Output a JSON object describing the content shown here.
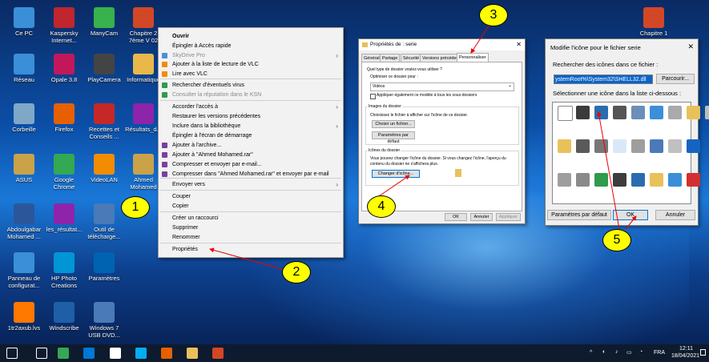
{
  "desktop": {
    "icons": [
      {
        "label": "Ce PC",
        "icon": "computer-icon",
        "color": "#3a8fd8"
      },
      {
        "label": "Kaspersky Internet...",
        "icon": "kaspersky-icon",
        "color": "#c0262d"
      },
      {
        "label": "ManyCam",
        "icon": "manycam-icon",
        "color": "#37b24d"
      },
      {
        "label": "Chapitre 2 7ème V 02",
        "icon": "powerpoint-file-icon",
        "color": "#d24726"
      },
      {
        "label": "Réseau",
        "icon": "network-icon",
        "color": "#3a8fd8"
      },
      {
        "label": "Opale 3.8",
        "icon": "opale-icon",
        "color": "#c2185b"
      },
      {
        "label": "PlayCamera",
        "icon": "camera-icon",
        "color": "#444444"
      },
      {
        "label": "Informatique",
        "icon": "folder-icon",
        "color": "#e8b94a"
      },
      {
        "label": "Corbeille",
        "icon": "recycle-bin-icon",
        "color": "#7fa8c8"
      },
      {
        "label": "Firefox",
        "icon": "firefox-icon",
        "color": "#e66000"
      },
      {
        "label": "Recettes et Conseils ...",
        "icon": "recipe-icon",
        "color": "#c62828"
      },
      {
        "label": "Résultats_d...",
        "icon": "archive-icon",
        "color": "#8e24aa"
      },
      {
        "label": "ASUS",
        "icon": "user-folder-icon",
        "color": "#c9a24a"
      },
      {
        "label": "Google Chrome",
        "icon": "chrome-icon",
        "color": "#34a853"
      },
      {
        "label": "VideoLAN",
        "icon": "vlc-icon",
        "color": "#f28c00"
      },
      {
        "label": "Ahmed Mohamed",
        "icon": "user-folder-icon",
        "color": "#c9a24a"
      },
      {
        "label": "Abdoulgabar Mohamed ...",
        "icon": "word-file-icon",
        "color": "#2b579a"
      },
      {
        "label": "les_résultat...",
        "icon": "archive-icon",
        "color": "#8e24aa"
      },
      {
        "label": "Outil de télécharge...",
        "icon": "download-tool-icon",
        "color": "#4a7ab8"
      },
      {
        "label": "Panneau de configurat...",
        "icon": "control-panel-icon",
        "color": "#3a8fd8"
      },
      {
        "label": "HP Photo Creations",
        "icon": "hp-photo-icon",
        "color": "#0096d6"
      },
      {
        "label": "Paramètres",
        "icon": "settings-gear-icon",
        "color": "#0063b1"
      },
      {
        "label": "1tr2axub.lvs",
        "icon": "avast-icon",
        "color": "#ff7800"
      },
      {
        "label": "Windscribe",
        "icon": "windscribe-icon",
        "color": "#1e5fa8"
      },
      {
        "label": "Windows 7 USB DVD...",
        "icon": "usb-dvd-icon",
        "color": "#4a7ab8"
      },
      {
        "label": "Chapitre 1",
        "icon": "powerpoint-file-icon",
        "color": "#d24726"
      }
    ]
  },
  "context_menu": {
    "items": [
      {
        "label": "Ouvrir",
        "style": "bold",
        "icon": "",
        "arrow": false
      },
      {
        "label": "Épingler à Accès rapide",
        "style": "",
        "icon": "",
        "arrow": false
      },
      {
        "label": "SkyDrive Pro",
        "style": "dis",
        "icon": "skydrive-icon",
        "arrow": true
      },
      {
        "label": "Ajouter à la liste de lecture de VLC",
        "style": "",
        "icon": "vlc-icon",
        "arrow": false
      },
      {
        "label": "Lire avec VLC",
        "style": "",
        "icon": "vlc-icon",
        "arrow": false
      },
      {
        "label": "Rechercher d'éventuels virus",
        "style": "",
        "icon": "shield-icon",
        "arrow": false
      },
      {
        "label": "Consulter la réputation dans le KSN",
        "style": "dis",
        "icon": "shield-icon",
        "arrow": false
      },
      {
        "label": "Accorder l'accès à",
        "style": "",
        "icon": "",
        "arrow": true
      },
      {
        "label": "Restaurer les versions précédentes",
        "style": "",
        "icon": "",
        "arrow": false
      },
      {
        "label": "Inclure dans la bibliothèque",
        "style": "",
        "icon": "",
        "arrow": true
      },
      {
        "label": "Épingler à l'écran de démarrage",
        "style": "",
        "icon": "",
        "arrow": false
      },
      {
        "label": "Ajouter à l'archive...",
        "style": "",
        "icon": "winrar-icon",
        "arrow": false
      },
      {
        "label": "Ajouter à \"Ahmed Mohamed.rar\"",
        "style": "",
        "icon": "winrar-icon",
        "arrow": false
      },
      {
        "label": "Compresser et envoyer par e-mail...",
        "style": "",
        "icon": "winrar-icon",
        "arrow": false
      },
      {
        "label": "Compresser dans \"Ahmed Mohamed.rar\" et envoyer par e-mail",
        "style": "",
        "icon": "winrar-icon",
        "arrow": false
      },
      {
        "label": "Envoyer vers",
        "style": "",
        "icon": "",
        "arrow": true
      },
      {
        "label": "Couper",
        "style": "",
        "icon": "",
        "arrow": false
      },
      {
        "label": "Copier",
        "style": "",
        "icon": "",
        "arrow": false
      },
      {
        "label": "Créer un raccourci",
        "style": "",
        "icon": "",
        "arrow": false
      },
      {
        "label": "Supprimer",
        "style": "",
        "icon": "",
        "arrow": false
      },
      {
        "label": "Renommer",
        "style": "",
        "icon": "",
        "arrow": false
      },
      {
        "label": "Propriétés",
        "style": "",
        "icon": "",
        "arrow": false
      }
    ]
  },
  "properties_dialog": {
    "title": "Propriétés de : serie",
    "tabs": [
      "Général",
      "Partage",
      "Sécurité",
      "Versions précédentes",
      "Personnaliser"
    ],
    "active_tab": "Personnaliser",
    "q_type": "Quel type de dossier voulez-vous utiliser ?",
    "optimize_label": "Optimiser ce dossier pour :",
    "optimize_value": "Vidéos",
    "apply_subfolders": "Appliquer également ce modèle à tous les sous-dossiers",
    "images_group": "Images du dossier",
    "images_desc": "Choisissez le fichier à afficher sur l'icône de ce dossier.",
    "choose_file_btn": "Choisir un fichier...",
    "restore_default_btn": "Paramètres par défaut",
    "icons_group": "Icônes du dossier",
    "icons_desc_1": "Vous pouvez changer l'icône du dossier. Si vous changez l'icône, l'aperçu du",
    "icons_desc_2": "contenu du dossier ne s'affichera plus.",
    "change_icon_btn": "Changer d'icône...",
    "ok": "OK",
    "cancel": "Annuler",
    "apply": "Appliquer"
  },
  "change_icon_dialog": {
    "title": "Modifie l'icône pour le fichier serie",
    "search_label": "Rechercher des icônes dans ce fichier :",
    "path": "ystemRoot%\\System32\\SHELL32.dll",
    "browse_btn": "Parcourir...",
    "select_label": "Sélectionner une icône dans la liste ci-dessous :",
    "defaults_btn": "Paramètres par défaut",
    "ok": "OK",
    "cancel": "Annuler",
    "icons": [
      "blank-file-icon",
      "folder-icon",
      "drive-icon",
      "chip-icon",
      "printer-icon",
      "drive-icon",
      "monitor-icon",
      "disk-icon",
      "globe-icon",
      "cpu-icon",
      "window-icon",
      "floppy-icon",
      "drive-net-icon",
      "drive-icon",
      "network-icon",
      "search-icon",
      "display-icon",
      "folder-icon",
      "drive-icon",
      "cd-icon",
      "network-icon",
      "folder-icon",
      "help-icon",
      "power-icon",
      "drive-icon"
    ]
  },
  "taskbar": {
    "time": "12:11",
    "date": "18/04/2021",
    "lang": "FRA",
    "icons": [
      "windows-start-icon",
      "search-icon",
      "chrome-icon",
      "edge-icon",
      "store-icon",
      "skype-icon",
      "firefox-icon",
      "file-explorer-icon",
      "powerpoint-icon"
    ]
  },
  "annotations": [
    "1",
    "2",
    "3",
    "4",
    "5"
  ]
}
